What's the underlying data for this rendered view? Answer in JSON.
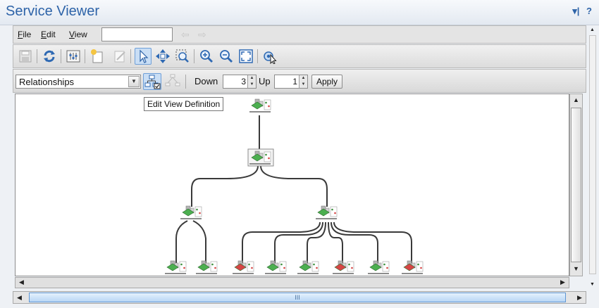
{
  "window": {
    "title": "Service Viewer",
    "controls": [
      "▾|",
      "?"
    ]
  },
  "menu": {
    "items": [
      {
        "label": "File",
        "accel": "F",
        "rest": "ile"
      },
      {
        "label": "Edit",
        "accel": "E",
        "rest": "dit"
      },
      {
        "label": "View",
        "accel": "V",
        "rest": "iew"
      }
    ],
    "search_value": ""
  },
  "toolbar": {
    "icons": [
      "save-icon",
      "refresh-icon",
      "view-settings-icon",
      "new-view-icon",
      "edit-icon",
      "select-pointer-icon",
      "pan-icon",
      "zoom-area-icon",
      "zoom-in-icon",
      "zoom-out-icon",
      "fit-to-window-icon",
      "layout-icon"
    ],
    "active_icon": "select-pointer-icon"
  },
  "relationship_bar": {
    "select_value": "Relationships",
    "down_label": "Down",
    "down_value": "3",
    "up_label": "Up",
    "up_value": "1",
    "apply_label": "Apply",
    "active_icon": "edit-view-definition-icon"
  },
  "tooltip": {
    "text": "Edit View Definition"
  },
  "graph": {
    "edge_color": "#3a3a3a",
    "status_colors": {
      "ok": "#4caf50",
      "critical": "#d64545",
      "neutral": "#c8c8c8"
    },
    "nodes": [
      {
        "id": "root",
        "status": "ok",
        "label": ""
      },
      {
        "id": "level1",
        "status": "ok",
        "label": ""
      },
      {
        "id": "left-group",
        "status": "ok",
        "label": ""
      },
      {
        "id": "right-group",
        "status": "ok",
        "label": ""
      },
      {
        "id": "leaf-1",
        "status": "ok",
        "label": ""
      },
      {
        "id": "leaf-2",
        "status": "ok",
        "label": ""
      },
      {
        "id": "leaf-3",
        "status": "critical",
        "label": ""
      },
      {
        "id": "leaf-4",
        "status": "ok",
        "label": ""
      },
      {
        "id": "leaf-5",
        "status": "ok",
        "label": ""
      },
      {
        "id": "leaf-6",
        "status": "critical",
        "label": ""
      },
      {
        "id": "leaf-7",
        "status": "ok",
        "label": ""
      },
      {
        "id": "leaf-8",
        "status": "critical",
        "label": ""
      }
    ]
  },
  "scrollbar": {
    "grip": "III"
  }
}
